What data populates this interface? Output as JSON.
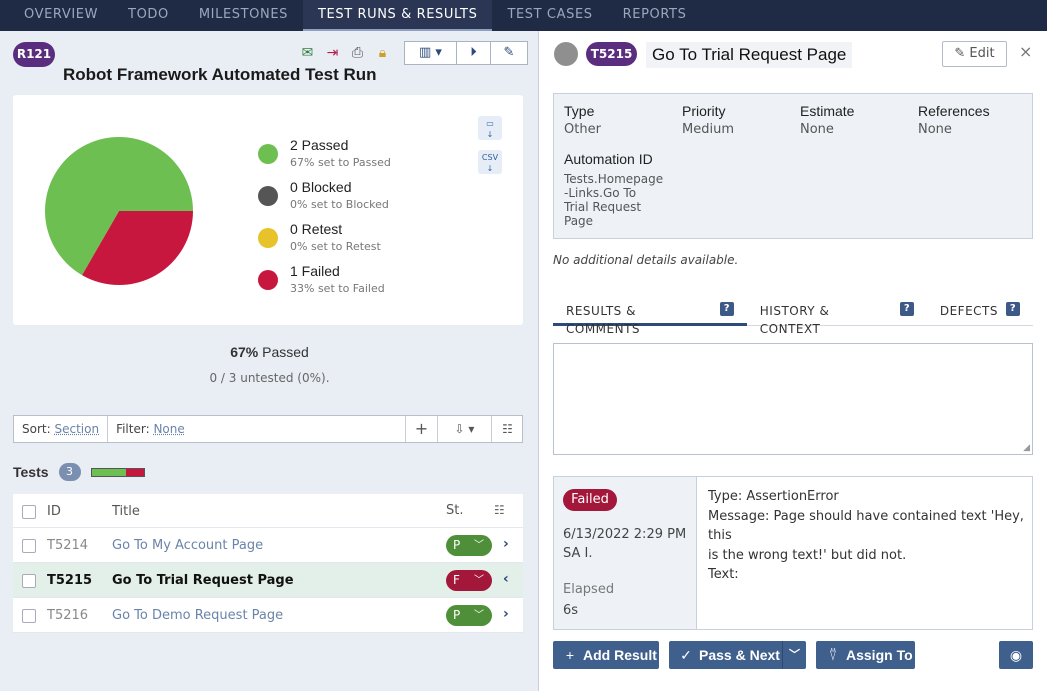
{
  "nav": {
    "tabs": [
      "OVERVIEW",
      "TODO",
      "MILESTONES",
      "TEST RUNS & RESULTS",
      "TEST CASES",
      "REPORTS"
    ],
    "active_index": 3
  },
  "run": {
    "badge": "R121",
    "title": "Robot Framework Automated Test Run",
    "summary_pct": "67%",
    "summary_word": "Passed",
    "untested": "0 / 3 untested (0%)."
  },
  "chart_data": {
    "type": "pie",
    "slices": [
      {
        "name": "Passed",
        "value": 2,
        "color": "#6ebf52"
      },
      {
        "name": "Blocked",
        "value": 0,
        "color": "#555555"
      },
      {
        "name": "Retest",
        "value": 0,
        "color": "#e8c229"
      },
      {
        "name": "Failed",
        "value": 1,
        "color": "#c8173f"
      }
    ]
  },
  "legend": [
    {
      "label": "2 Passed",
      "sub": "67% set to Passed",
      "color": "#6ebf52"
    },
    {
      "label": "0 Blocked",
      "sub": "0% set to Blocked",
      "color": "#555555"
    },
    {
      "label": "0 Retest",
      "sub": "0% set to Retest",
      "color": "#e8c229"
    },
    {
      "label": "1 Failed",
      "sub": "33% set to Failed",
      "color": "#c8173f"
    }
  ],
  "export_icons": {
    "chart_label": "",
    "csv_label": "CSV"
  },
  "filterbar": {
    "sort_label": "Sort:",
    "sort_value": "Section",
    "filter_label": "Filter:",
    "filter_value": "None",
    "add_label": "+"
  },
  "tests": {
    "title": "Tests",
    "count": "3",
    "progress": {
      "passed_fraction": 0.67,
      "failed_fraction": 0.33
    },
    "headers": {
      "id": "ID",
      "title": "Title",
      "status": "St."
    },
    "rows": [
      {
        "id": "T5214",
        "title": "Go To My Account Page",
        "status": "P",
        "state": "pass",
        "selected": false
      },
      {
        "id": "T5215",
        "title": "Go To Trial Request Page",
        "status": "F",
        "state": "fail",
        "selected": true
      },
      {
        "id": "T5216",
        "title": "Go To Demo Request Page",
        "status": "P",
        "state": "pass",
        "selected": false
      }
    ]
  },
  "case": {
    "badge": "T5215",
    "title": "Go To Trial Request Page",
    "edit_label": "Edit",
    "close_label": "×",
    "props": {
      "type_label": "Type",
      "type_value": "Other",
      "priority_label": "Priority",
      "priority_value": "Medium",
      "estimate_label": "Estimate",
      "estimate_value": "None",
      "references_label": "References",
      "references_value": "None",
      "automation_label": "Automation ID",
      "automation_lines": [
        "Tests.Homepage",
        "-Links.Go To",
        "Trial Request",
        "Page"
      ]
    },
    "no_details": "No additional details available.",
    "tabs": [
      "RESULTS & COMMENTS",
      "HISTORY & CONTEXT",
      "DEFECTS"
    ],
    "tab_help": "?"
  },
  "result": {
    "status": "Failed",
    "date": "6/13/2022 2:29 PM",
    "user": "SA I.",
    "elapsed_label": "Elapsed",
    "elapsed_value": "6s",
    "lines": [
      "Type: AssertionError",
      "Message: Page should have contained text 'Hey, this",
      "is the wrong text!' but did not.",
      "Text:"
    ]
  },
  "actions": {
    "add_result": "Add Result",
    "pass_next": "Pass & Next",
    "assign_to": "Assign To"
  }
}
